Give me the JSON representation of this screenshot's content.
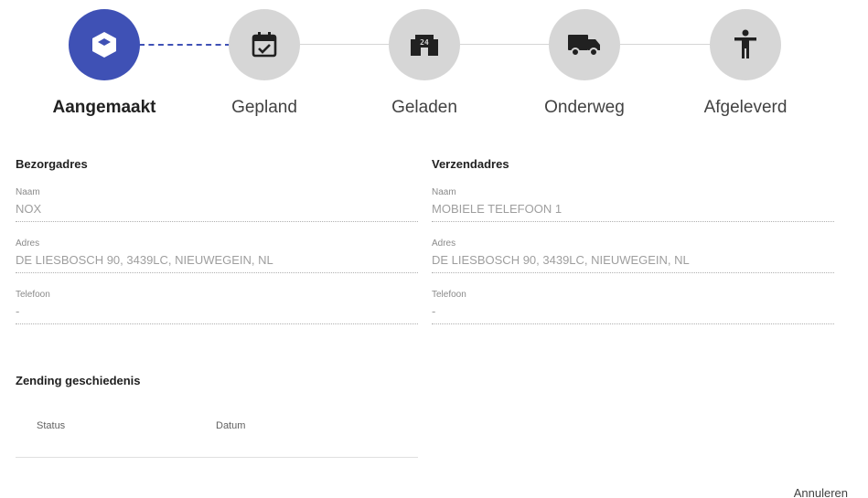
{
  "stepper": {
    "steps": [
      {
        "label": "Aangemaakt",
        "icon": "box-icon",
        "active": true
      },
      {
        "label": "Gepland",
        "icon": "calendar-check-icon",
        "active": false
      },
      {
        "label": "Geladen",
        "icon": "warehouse-24-icon",
        "active": false
      },
      {
        "label": "Onderweg",
        "icon": "truck-icon",
        "active": false
      },
      {
        "label": "Afgeleverd",
        "icon": "person-icon",
        "active": false
      }
    ],
    "active_color": "#3f51b5",
    "inactive_color": "#d6d6d6"
  },
  "billing": {
    "title": "Bezorgadres",
    "name_label": "Naam",
    "name_value": "NOX",
    "address_label": "Adres",
    "address_value": "DE LIESBOSCH 90, 3439LC, NIEUWEGEIN, NL",
    "phone_label": "Telefoon",
    "phone_value": "-"
  },
  "shipping": {
    "title": "Verzendadres",
    "name_label": "Naam",
    "name_value": "MOBIELE TELEFOON 1",
    "address_label": "Adres",
    "address_value": "DE LIESBOSCH 90, 3439LC, NIEUWEGEIN, NL",
    "phone_label": "Telefoon",
    "phone_value": "-"
  },
  "history": {
    "title": "Zending geschiedenis",
    "columns": [
      "Status",
      "Datum"
    ]
  },
  "actions": {
    "cancel_label": "Annuleren"
  }
}
